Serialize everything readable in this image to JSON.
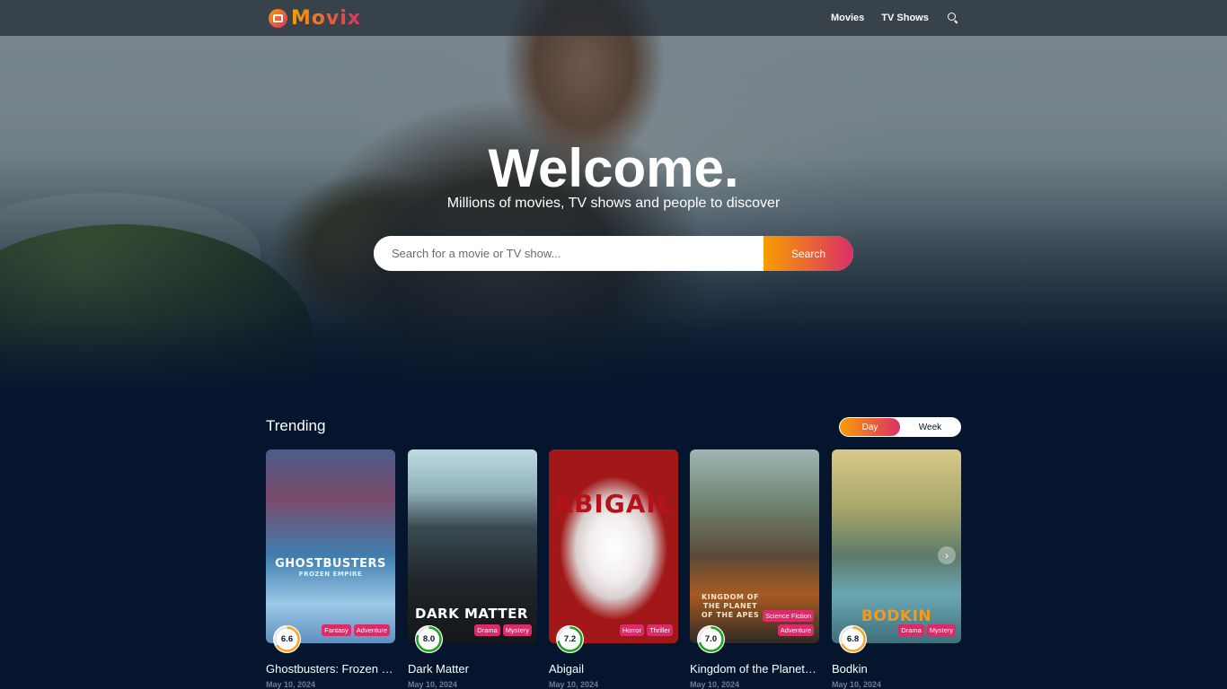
{
  "header": {
    "logo_text": "Movix",
    "nav": [
      "Movies",
      "TV Shows"
    ]
  },
  "hero": {
    "title": "Welcome.",
    "subtitle": "Millions of movies, TV shows and people to discover",
    "search_placeholder": "Search for a movie or TV show...",
    "search_button": "Search"
  },
  "trending": {
    "title": "Trending",
    "tabs": [
      "Day",
      "Week"
    ],
    "active_tab": "Day",
    "items": [
      {
        "title": "Ghostbusters: Frozen Empire",
        "poster_text": "GHOSTBUSTERS",
        "poster_subtext": "FROZEN EMPIRE",
        "rating": "6.6",
        "rating_value": 6.6,
        "rating_color": "#f5a623",
        "genres": [
          "Fantasy",
          "Adventure"
        ],
        "date": "May 10, 2024"
      },
      {
        "title": "Dark Matter",
        "poster_text": "DARK MATTER",
        "poster_subtext": "",
        "rating": "8.0",
        "rating_value": 8.0,
        "rating_color": "#1fa31f",
        "genres": [
          "Drama",
          "Mystery"
        ],
        "date": "May 10, 2024"
      },
      {
        "title": "Abigail",
        "poster_text": "ABIGAIL",
        "poster_subtext": "",
        "rating": "7.2",
        "rating_value": 7.2,
        "rating_color": "#1fa31f",
        "genres": [
          "Horror",
          "Thriller"
        ],
        "date": "May 10, 2024"
      },
      {
        "title": "Kingdom of the Planet of the Apes",
        "poster_text": "KINGDOM OF THE PLANET OF THE APES",
        "poster_subtext": "",
        "rating": "7.0",
        "rating_value": 7.0,
        "rating_color": "#1fa31f",
        "genres": [
          "Science Fiction",
          "Adventure"
        ],
        "date": "May 10, 2024"
      },
      {
        "title": "Bodkin",
        "poster_text": "BODKIN",
        "poster_subtext": "",
        "rating": "6.8",
        "rating_value": 6.8,
        "rating_color": "#f5a623",
        "genres": [
          "Drama",
          "Mystery"
        ],
        "date": "May 10, 2024"
      }
    ]
  },
  "colors": {
    "background": "#04152d",
    "gradient_start": "#f89e00",
    "gradient_end": "#da2f68",
    "genre_badge": "#da2c68"
  },
  "icons": {
    "search": "search-icon",
    "next": "chevron-right-icon"
  }
}
